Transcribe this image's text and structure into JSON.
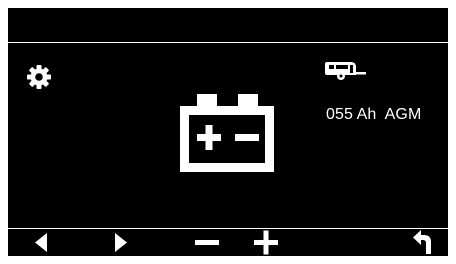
{
  "colors": {
    "screen_background": "#000000",
    "foreground": "#ffffff"
  },
  "header": {
    "title": ""
  },
  "main": {
    "settings_icon": "gear-icon",
    "battery_icon": "battery-icon",
    "vehicle_icon": "caravan-icon",
    "capacity_text": "055 Ah  AGM"
  },
  "navbar": {
    "buttons": [
      {
        "icon": "left-arrow-icon"
      },
      {
        "icon": "right-arrow-icon"
      },
      {
        "icon": "minus-icon"
      },
      {
        "icon": "plus-icon"
      },
      {
        "icon": "back-icon"
      }
    ]
  }
}
